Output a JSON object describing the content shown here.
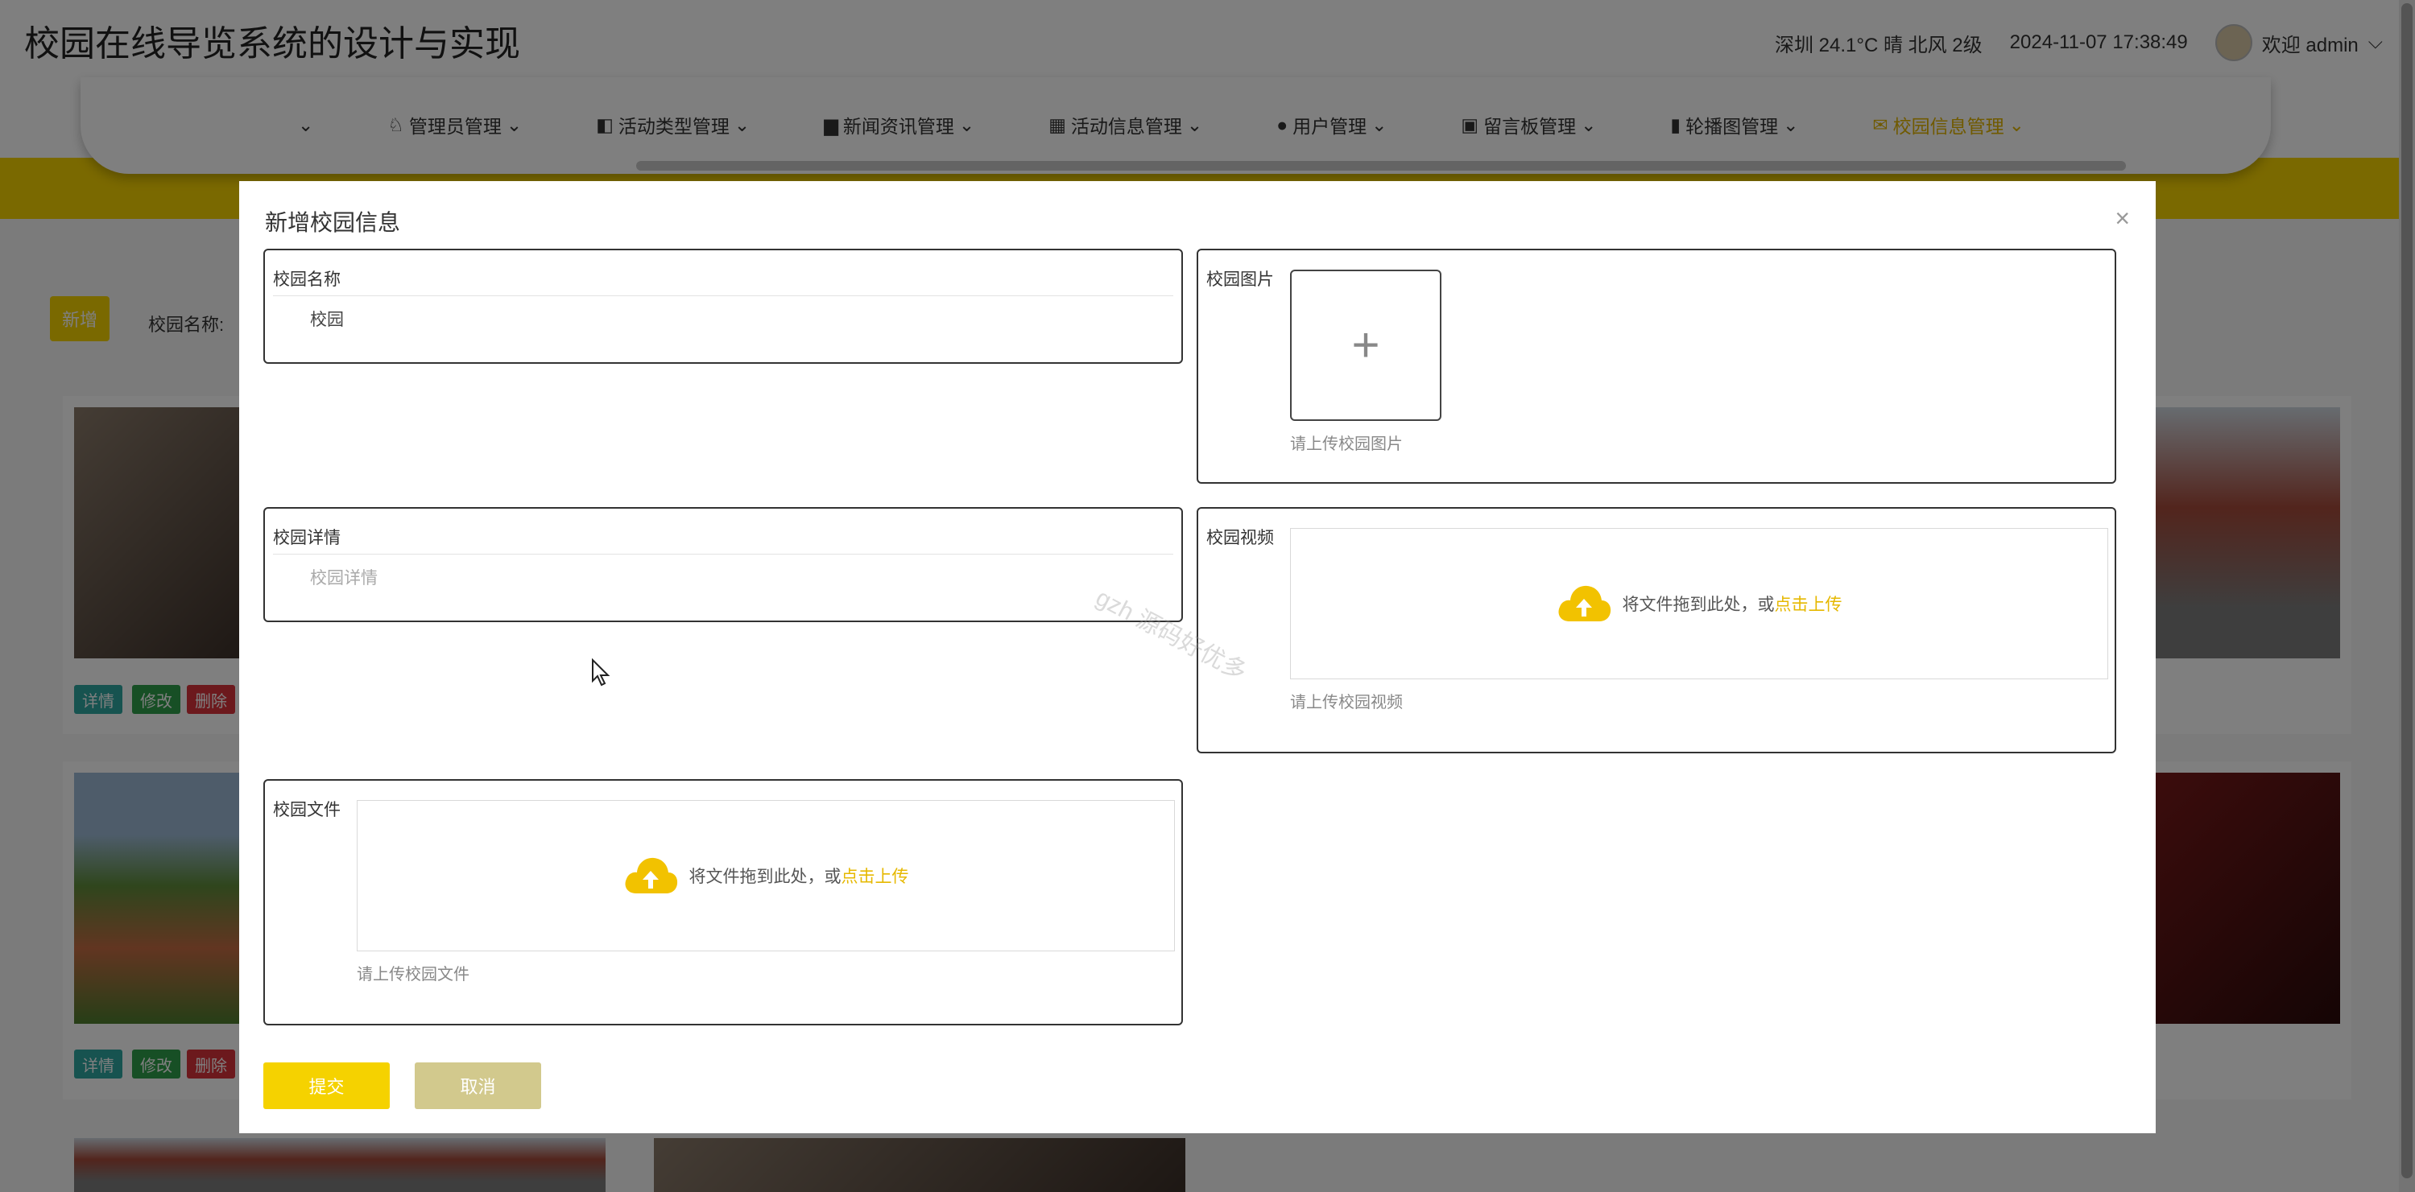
{
  "app": {
    "title": "校园在线导览系统的设计与实现",
    "weather": "深圳 24.1°C 晴 北风 2级",
    "datetime": "2024-11-07 17:38:49",
    "welcome": "欢迎 admin"
  },
  "nav": {
    "items": [
      {
        "label": "",
        "icon": "home-icon"
      },
      {
        "label": "管理员管理",
        "icon": "user-icon"
      },
      {
        "label": "活动类型管理",
        "icon": "square-icon"
      },
      {
        "label": "新闻资讯管理",
        "icon": "folder-icon"
      },
      {
        "label": "活动信息管理",
        "icon": "grid-icon"
      },
      {
        "label": "用户管理",
        "icon": "person-icon"
      },
      {
        "label": "留言板管理",
        "icon": "chat-icon"
      },
      {
        "label": "轮播图管理",
        "icon": "film-icon"
      },
      {
        "label": "校园信息管理",
        "icon": "envelope-icon"
      }
    ],
    "active_index": 8
  },
  "toolbar": {
    "new_label": "新增",
    "filter_label": "校园名称:"
  },
  "cards": {
    "detail": "详情",
    "edit": "修改",
    "delete": "删除"
  },
  "modal": {
    "title": "新增校园信息",
    "close": "×",
    "name": {
      "label": "校园名称",
      "value": "校园"
    },
    "image": {
      "label": "校园图片",
      "hint": "请上传校园图片"
    },
    "detail": {
      "label": "校园详情",
      "placeholder": "校园详情"
    },
    "video": {
      "label": "校园视频",
      "drop_text": "将文件拖到此处，或",
      "drop_link": "点击上传",
      "hint": "请上传校园视频"
    },
    "file": {
      "label": "校园文件",
      "drop_text": "将文件拖到此处，或",
      "drop_link": "点击上传",
      "hint": "请上传校园文件"
    },
    "submit": "提交",
    "cancel": "取消"
  },
  "watermark": "gzh 源码好优多",
  "colors": {
    "accent": "#f5d200",
    "cancel": "#d2c98d",
    "link": "#e6b800"
  }
}
